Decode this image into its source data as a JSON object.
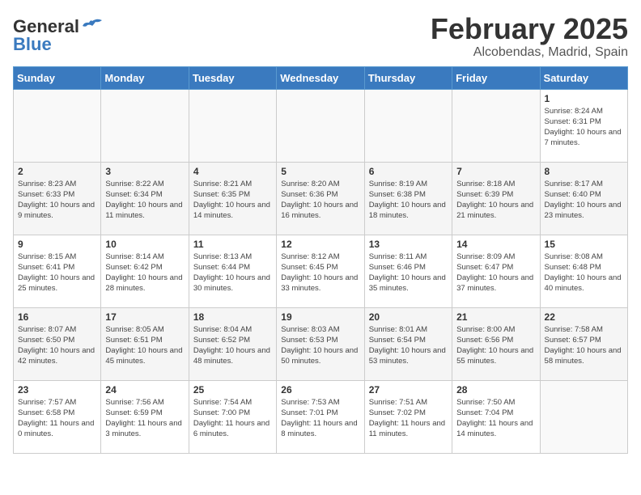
{
  "header": {
    "logo_general": "General",
    "logo_blue": "Blue",
    "month_title": "February 2025",
    "location": "Alcobendas, Madrid, Spain"
  },
  "days_of_week": [
    "Sunday",
    "Monday",
    "Tuesday",
    "Wednesday",
    "Thursday",
    "Friday",
    "Saturday"
  ],
  "weeks": [
    [
      {
        "day": "",
        "info": ""
      },
      {
        "day": "",
        "info": ""
      },
      {
        "day": "",
        "info": ""
      },
      {
        "day": "",
        "info": ""
      },
      {
        "day": "",
        "info": ""
      },
      {
        "day": "",
        "info": ""
      },
      {
        "day": "1",
        "info": "Sunrise: 8:24 AM\nSunset: 6:31 PM\nDaylight: 10 hours and 7 minutes."
      }
    ],
    [
      {
        "day": "2",
        "info": "Sunrise: 8:23 AM\nSunset: 6:33 PM\nDaylight: 10 hours and 9 minutes."
      },
      {
        "day": "3",
        "info": "Sunrise: 8:22 AM\nSunset: 6:34 PM\nDaylight: 10 hours and 11 minutes."
      },
      {
        "day": "4",
        "info": "Sunrise: 8:21 AM\nSunset: 6:35 PM\nDaylight: 10 hours and 14 minutes."
      },
      {
        "day": "5",
        "info": "Sunrise: 8:20 AM\nSunset: 6:36 PM\nDaylight: 10 hours and 16 minutes."
      },
      {
        "day": "6",
        "info": "Sunrise: 8:19 AM\nSunset: 6:38 PM\nDaylight: 10 hours and 18 minutes."
      },
      {
        "day": "7",
        "info": "Sunrise: 8:18 AM\nSunset: 6:39 PM\nDaylight: 10 hours and 21 minutes."
      },
      {
        "day": "8",
        "info": "Sunrise: 8:17 AM\nSunset: 6:40 PM\nDaylight: 10 hours and 23 minutes."
      }
    ],
    [
      {
        "day": "9",
        "info": "Sunrise: 8:15 AM\nSunset: 6:41 PM\nDaylight: 10 hours and 25 minutes."
      },
      {
        "day": "10",
        "info": "Sunrise: 8:14 AM\nSunset: 6:42 PM\nDaylight: 10 hours and 28 minutes."
      },
      {
        "day": "11",
        "info": "Sunrise: 8:13 AM\nSunset: 6:44 PM\nDaylight: 10 hours and 30 minutes."
      },
      {
        "day": "12",
        "info": "Sunrise: 8:12 AM\nSunset: 6:45 PM\nDaylight: 10 hours and 33 minutes."
      },
      {
        "day": "13",
        "info": "Sunrise: 8:11 AM\nSunset: 6:46 PM\nDaylight: 10 hours and 35 minutes."
      },
      {
        "day": "14",
        "info": "Sunrise: 8:09 AM\nSunset: 6:47 PM\nDaylight: 10 hours and 37 minutes."
      },
      {
        "day": "15",
        "info": "Sunrise: 8:08 AM\nSunset: 6:48 PM\nDaylight: 10 hours and 40 minutes."
      }
    ],
    [
      {
        "day": "16",
        "info": "Sunrise: 8:07 AM\nSunset: 6:50 PM\nDaylight: 10 hours and 42 minutes."
      },
      {
        "day": "17",
        "info": "Sunrise: 8:05 AM\nSunset: 6:51 PM\nDaylight: 10 hours and 45 minutes."
      },
      {
        "day": "18",
        "info": "Sunrise: 8:04 AM\nSunset: 6:52 PM\nDaylight: 10 hours and 48 minutes."
      },
      {
        "day": "19",
        "info": "Sunrise: 8:03 AM\nSunset: 6:53 PM\nDaylight: 10 hours and 50 minutes."
      },
      {
        "day": "20",
        "info": "Sunrise: 8:01 AM\nSunset: 6:54 PM\nDaylight: 10 hours and 53 minutes."
      },
      {
        "day": "21",
        "info": "Sunrise: 8:00 AM\nSunset: 6:56 PM\nDaylight: 10 hours and 55 minutes."
      },
      {
        "day": "22",
        "info": "Sunrise: 7:58 AM\nSunset: 6:57 PM\nDaylight: 10 hours and 58 minutes."
      }
    ],
    [
      {
        "day": "23",
        "info": "Sunrise: 7:57 AM\nSunset: 6:58 PM\nDaylight: 11 hours and 0 minutes."
      },
      {
        "day": "24",
        "info": "Sunrise: 7:56 AM\nSunset: 6:59 PM\nDaylight: 11 hours and 3 minutes."
      },
      {
        "day": "25",
        "info": "Sunrise: 7:54 AM\nSunset: 7:00 PM\nDaylight: 11 hours and 6 minutes."
      },
      {
        "day": "26",
        "info": "Sunrise: 7:53 AM\nSunset: 7:01 PM\nDaylight: 11 hours and 8 minutes."
      },
      {
        "day": "27",
        "info": "Sunrise: 7:51 AM\nSunset: 7:02 PM\nDaylight: 11 hours and 11 minutes."
      },
      {
        "day": "28",
        "info": "Sunrise: 7:50 AM\nSunset: 7:04 PM\nDaylight: 11 hours and 14 minutes."
      },
      {
        "day": "",
        "info": ""
      }
    ]
  ]
}
